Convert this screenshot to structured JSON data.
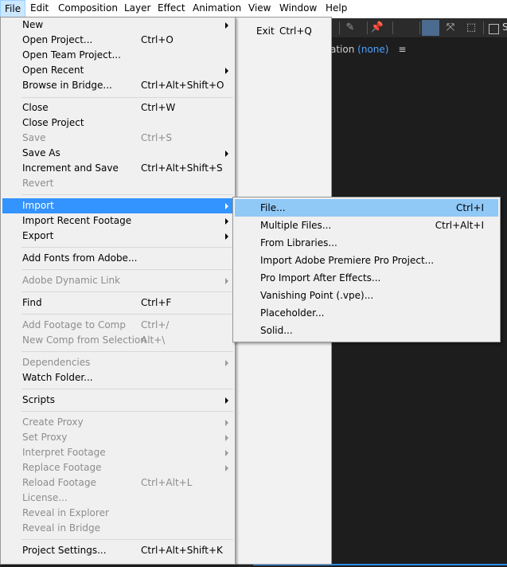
{
  "menubar": {
    "items": [
      "File",
      "Edit",
      "Composition",
      "Layer",
      "Effect",
      "Animation",
      "View",
      "Window",
      "Help"
    ],
    "active": "File"
  },
  "panel": {
    "label_suffix": "ation",
    "none_label": "(none)",
    "menu_icon": "hamburger-icon",
    "checkbox_label": "S"
  },
  "file_menu": {
    "new": {
      "label": "New"
    },
    "open_project": {
      "label": "Open Project...",
      "shortcut": "Ctrl+O"
    },
    "open_team_project": {
      "label": "Open Team Project..."
    },
    "open_recent": {
      "label": "Open Recent"
    },
    "browse_in_bridge": {
      "label": "Browse in Bridge...",
      "shortcut": "Ctrl+Alt+Shift+O"
    },
    "close": {
      "label": "Close",
      "shortcut": "Ctrl+W"
    },
    "close_project": {
      "label": "Close Project"
    },
    "save": {
      "label": "Save",
      "shortcut": "Ctrl+S"
    },
    "save_as": {
      "label": "Save As"
    },
    "increment_and_save": {
      "label": "Increment and Save",
      "shortcut": "Ctrl+Alt+Shift+S"
    },
    "revert": {
      "label": "Revert"
    },
    "import": {
      "label": "Import"
    },
    "import_recent_footage": {
      "label": "Import Recent Footage"
    },
    "export": {
      "label": "Export"
    },
    "add_fonts": {
      "label": "Add Fonts from Adobe..."
    },
    "adobe_dynamic_link": {
      "label": "Adobe Dynamic Link"
    },
    "find": {
      "label": "Find",
      "shortcut": "Ctrl+F"
    },
    "add_footage_to_comp": {
      "label": "Add Footage to Comp",
      "shortcut": "Ctrl+/"
    },
    "new_comp_from_selection": {
      "label": "New Comp from Selection",
      "shortcut": "Alt+\\"
    },
    "dependencies": {
      "label": "Dependencies"
    },
    "watch_folder": {
      "label": "Watch Folder..."
    },
    "scripts": {
      "label": "Scripts"
    },
    "create_proxy": {
      "label": "Create Proxy"
    },
    "set_proxy": {
      "label": "Set Proxy"
    },
    "interpret_footage": {
      "label": "Interpret Footage"
    },
    "replace_footage": {
      "label": "Replace Footage"
    },
    "reload_footage": {
      "label": "Reload Footage",
      "shortcut": "Ctrl+Alt+L"
    },
    "license": {
      "label": "License..."
    },
    "reveal_in_explorer": {
      "label": "Reveal in Explorer"
    },
    "reveal_in_bridge": {
      "label": "Reveal in Bridge"
    },
    "project_settings": {
      "label": "Project Settings...",
      "shortcut": "Ctrl+Alt+Shift+K"
    }
  },
  "exit_menu": {
    "exit": {
      "label": "Exit",
      "shortcut": "Ctrl+Q"
    }
  },
  "import_menu": {
    "file": {
      "label": "File...",
      "shortcut": "Ctrl+I"
    },
    "multiple_files": {
      "label": "Multiple Files...",
      "shortcut": "Ctrl+Alt+I"
    },
    "from_libraries": {
      "label": "From Libraries..."
    },
    "premiere_project": {
      "label": "Import Adobe Premiere Pro Project..."
    },
    "pro_import": {
      "label": "Pro Import After Effects..."
    },
    "vanishing_point": {
      "label": "Vanishing Point (.vpe)..."
    },
    "placeholder": {
      "label": "Placeholder..."
    },
    "solid": {
      "label": "Solid..."
    }
  },
  "colors": {
    "highlight": "#3393ff",
    "submenu_highlight": "#90c8f6",
    "menubar_active": "#cce8ff",
    "panel_link": "#4ea1ff"
  }
}
